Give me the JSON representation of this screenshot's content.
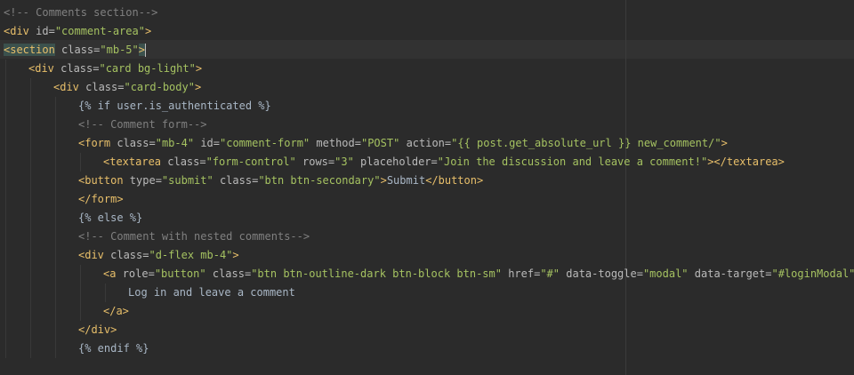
{
  "editor": {
    "language": "html-django",
    "colors": {
      "background": "#2b2b2b",
      "current_line": "#323232",
      "comment": "#808080",
      "tag": "#e8bf6a",
      "attribute": "#bababa",
      "string": "#a5c261",
      "text": "#a9b7c6",
      "tag_highlight": "#3b514d"
    },
    "lines": [
      {
        "indent": 0,
        "tokens": [
          {
            "t": "<!-- Comments section-->",
            "c": "comment"
          }
        ]
      },
      {
        "indent": 0,
        "tokens": [
          {
            "t": "<div ",
            "c": "tag"
          },
          {
            "t": "id=",
            "c": "attr"
          },
          {
            "t": "\"comment-area\"",
            "c": "str"
          },
          {
            "t": ">",
            "c": "tag"
          }
        ]
      },
      {
        "indent": 0,
        "current": true,
        "tokens": [
          {
            "t": "<section",
            "c": "tag",
            "hl": true
          },
          {
            "t": " ",
            "c": "tag"
          },
          {
            "t": "class=",
            "c": "attr"
          },
          {
            "t": "\"mb-5\"",
            "c": "str"
          },
          {
            "t": ">",
            "c": "tag",
            "hl": true
          },
          {
            "t": "",
            "c": "caret"
          }
        ]
      },
      {
        "indent": 1,
        "tokens": [
          {
            "t": "<div ",
            "c": "tag"
          },
          {
            "t": "class=",
            "c": "attr"
          },
          {
            "t": "\"card bg-light\"",
            "c": "str"
          },
          {
            "t": ">",
            "c": "tag"
          }
        ]
      },
      {
        "indent": 2,
        "tokens": [
          {
            "t": "<div ",
            "c": "tag"
          },
          {
            "t": "class=",
            "c": "attr"
          },
          {
            "t": "\"card-body\"",
            "c": "str"
          },
          {
            "t": ">",
            "c": "tag"
          }
        ]
      },
      {
        "indent": 3,
        "tokens": [
          {
            "t": "{% if user.is_authenticated %}",
            "c": "tpl"
          }
        ]
      },
      {
        "indent": 3,
        "tokens": [
          {
            "t": "<!-- Comment form-->",
            "c": "comment"
          }
        ]
      },
      {
        "indent": 3,
        "tokens": [
          {
            "t": "<form ",
            "c": "tag"
          },
          {
            "t": "class=",
            "c": "attr"
          },
          {
            "t": "\"mb-4\"",
            "c": "str"
          },
          {
            "t": " ",
            "c": "tag"
          },
          {
            "t": "id=",
            "c": "attr"
          },
          {
            "t": "\"comment-form\"",
            "c": "str"
          },
          {
            "t": " ",
            "c": "tag"
          },
          {
            "t": "method=",
            "c": "attr"
          },
          {
            "t": "\"POST\"",
            "c": "str"
          },
          {
            "t": " ",
            "c": "tag"
          },
          {
            "t": "action=",
            "c": "attr"
          },
          {
            "t": "\"{{ post.get_absolute_url }} new_comment/\"",
            "c": "str"
          },
          {
            "t": ">",
            "c": "tag"
          }
        ]
      },
      {
        "indent": 4,
        "tokens": [
          {
            "t": "<textarea ",
            "c": "tag"
          },
          {
            "t": "class=",
            "c": "attr"
          },
          {
            "t": "\"form-control\"",
            "c": "str"
          },
          {
            "t": " ",
            "c": "tag"
          },
          {
            "t": "rows=",
            "c": "attr"
          },
          {
            "t": "\"3\"",
            "c": "str"
          },
          {
            "t": " ",
            "c": "tag"
          },
          {
            "t": "placeholder=",
            "c": "attr"
          },
          {
            "t": "\"Join the discussion and leave a comment!\"",
            "c": "str"
          },
          {
            "t": "></textarea>",
            "c": "tag"
          }
        ]
      },
      {
        "indent": 3,
        "tokens": [
          {
            "t": "<button ",
            "c": "tag"
          },
          {
            "t": "type=",
            "c": "attr"
          },
          {
            "t": "\"submit\"",
            "c": "str"
          },
          {
            "t": " ",
            "c": "tag"
          },
          {
            "t": "class=",
            "c": "attr"
          },
          {
            "t": "\"btn btn-secondary\"",
            "c": "str"
          },
          {
            "t": ">",
            "c": "tag"
          },
          {
            "t": "Submit",
            "c": "text"
          },
          {
            "t": "</button>",
            "c": "tag"
          }
        ]
      },
      {
        "indent": 3,
        "tokens": [
          {
            "t": "</form>",
            "c": "tag"
          }
        ]
      },
      {
        "indent": 3,
        "tokens": [
          {
            "t": "{% else %}",
            "c": "tpl"
          }
        ]
      },
      {
        "indent": 3,
        "tokens": [
          {
            "t": "<!-- Comment with nested comments-->",
            "c": "comment"
          }
        ]
      },
      {
        "indent": 3,
        "tokens": [
          {
            "t": "<div ",
            "c": "tag"
          },
          {
            "t": "class=",
            "c": "attr"
          },
          {
            "t": "\"d-flex mb-4\"",
            "c": "str"
          },
          {
            "t": ">",
            "c": "tag"
          }
        ]
      },
      {
        "indent": 4,
        "tokens": [
          {
            "t": "<a ",
            "c": "tag"
          },
          {
            "t": "role=",
            "c": "attr"
          },
          {
            "t": "\"button\"",
            "c": "str"
          },
          {
            "t": " ",
            "c": "tag"
          },
          {
            "t": "class=",
            "c": "attr"
          },
          {
            "t": "\"btn btn-outline-dark btn-block btn-sm\"",
            "c": "str"
          },
          {
            "t": " ",
            "c": "tag"
          },
          {
            "t": "href=",
            "c": "attr"
          },
          {
            "t": "\"#\"",
            "c": "str"
          },
          {
            "t": " ",
            "c": "tag"
          },
          {
            "t": "data-toggle=",
            "c": "attr"
          },
          {
            "t": "\"modal\"",
            "c": "str"
          },
          {
            "t": " ",
            "c": "tag"
          },
          {
            "t": "data-target=",
            "c": "attr"
          },
          {
            "t": "\"#loginModal\"",
            "c": "str"
          },
          {
            "t": ">",
            "c": "tag"
          }
        ]
      },
      {
        "indent": 5,
        "tokens": [
          {
            "t": "Log in and leave a comment",
            "c": "text"
          }
        ]
      },
      {
        "indent": 4,
        "tokens": [
          {
            "t": "</a>",
            "c": "tag"
          }
        ]
      },
      {
        "indent": 3,
        "tokens": [
          {
            "t": "</div>",
            "c": "tag"
          }
        ]
      },
      {
        "indent": 3,
        "tokens": [
          {
            "t": "{% endif %}",
            "c": "tpl"
          }
        ]
      },
      {
        "indent": 0,
        "tokens": []
      }
    ]
  }
}
